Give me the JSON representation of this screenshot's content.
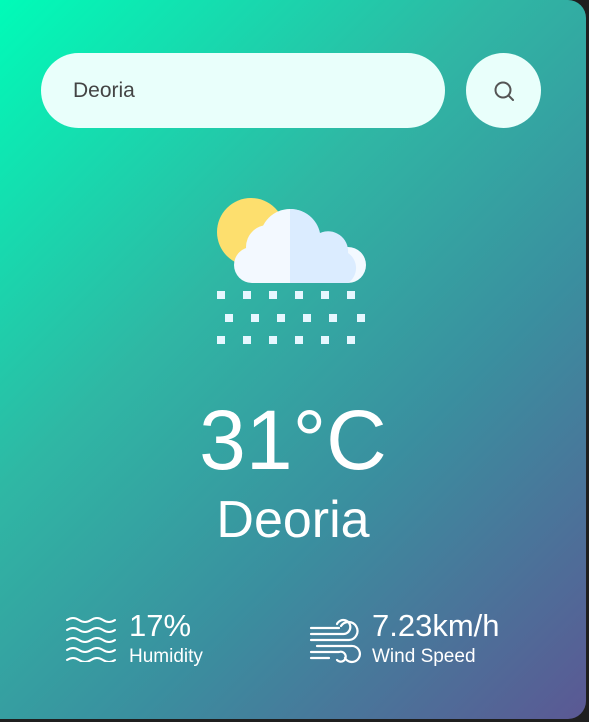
{
  "search": {
    "value": "Deoria",
    "button_icon": "search-icon"
  },
  "weather": {
    "icon": "cloud-sun-snow-icon",
    "temperature": "31°C",
    "city": "Deoria"
  },
  "stats": {
    "humidity": {
      "icon": "humidity-waves-icon",
      "value": "17%",
      "label": "Humidity"
    },
    "wind": {
      "icon": "wind-icon",
      "value": "7.23km/h",
      "label": "Wind Speed"
    }
  },
  "colors": {
    "gradient_start": "#00fcb8",
    "gradient_end": "#5b5894",
    "input_bg": "#e9fffb",
    "text": "#ffffff"
  }
}
